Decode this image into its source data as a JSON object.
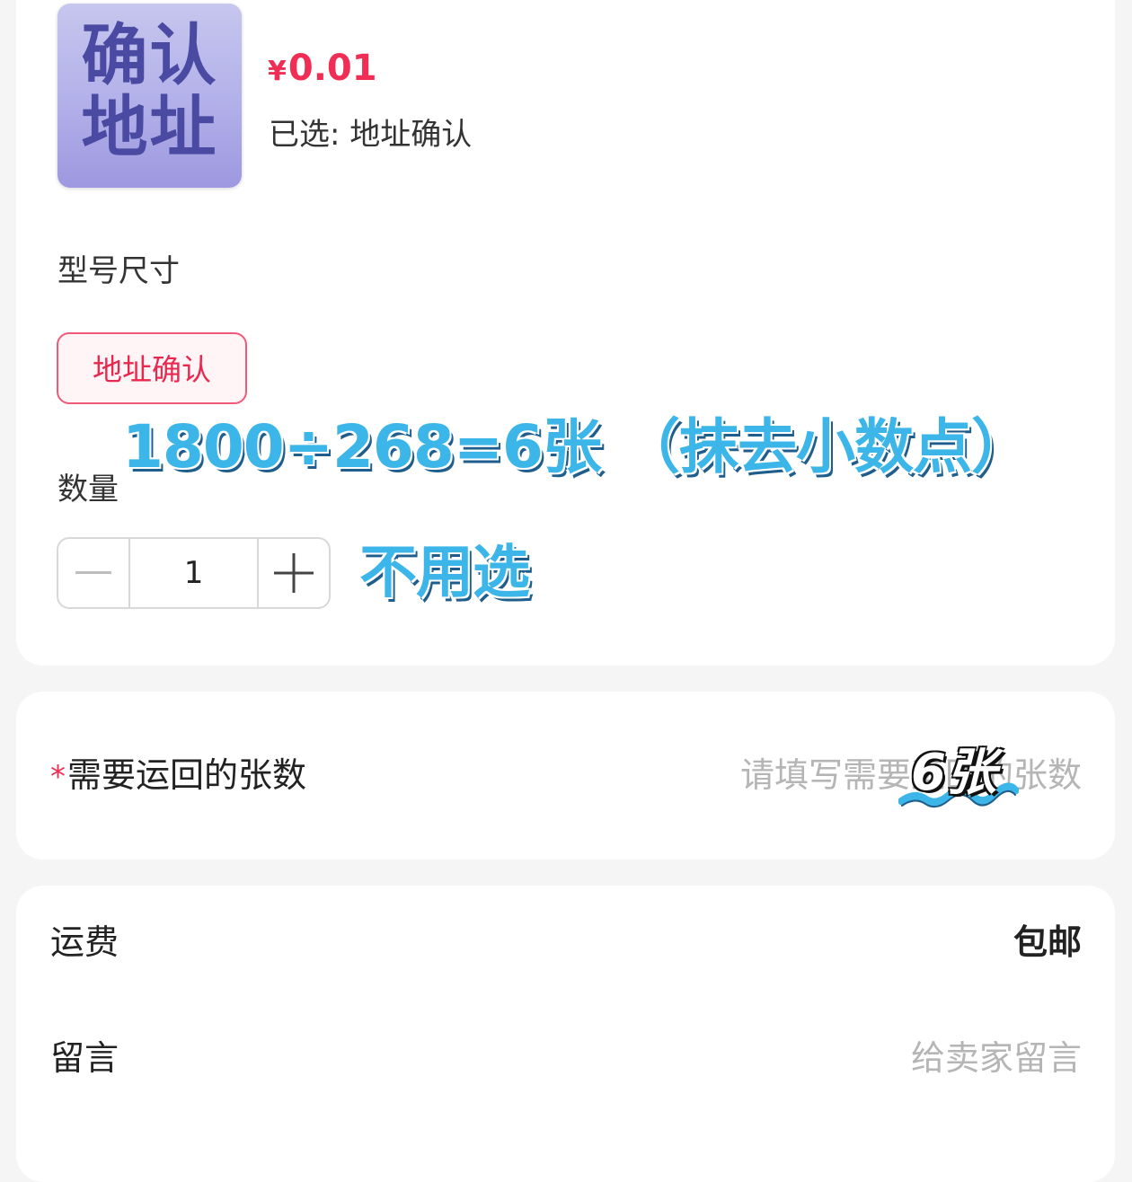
{
  "product": {
    "thumbnail_text_line1": "确认",
    "thumbnail_text_line2": "地址",
    "currency_symbol": "¥",
    "price": "0.01",
    "selected_text": "已选: 地址确认"
  },
  "spec": {
    "label": "型号尺寸",
    "options": [
      {
        "label": "地址确认",
        "selected": true
      }
    ]
  },
  "quantity": {
    "label": "数量",
    "value": "1",
    "decrement_icon": "minus-icon",
    "increment_icon": "plus-icon"
  },
  "annotations": {
    "formula": "1800÷268=6张 （抹去小数点）",
    "no_need_to_select": "不用选",
    "sheets_value": "6张"
  },
  "sheets_to_return": {
    "required_mark": "*",
    "label": "需要运回的张数",
    "placeholder": "请填写需要运回的张数"
  },
  "shipping": {
    "label": "运费",
    "value": "包邮"
  },
  "message": {
    "label": "留言",
    "placeholder": "给卖家留言"
  },
  "colors": {
    "accent": "#f02d55",
    "annotation": "#3cb6e8",
    "placeholder": "#b5b5b5"
  }
}
